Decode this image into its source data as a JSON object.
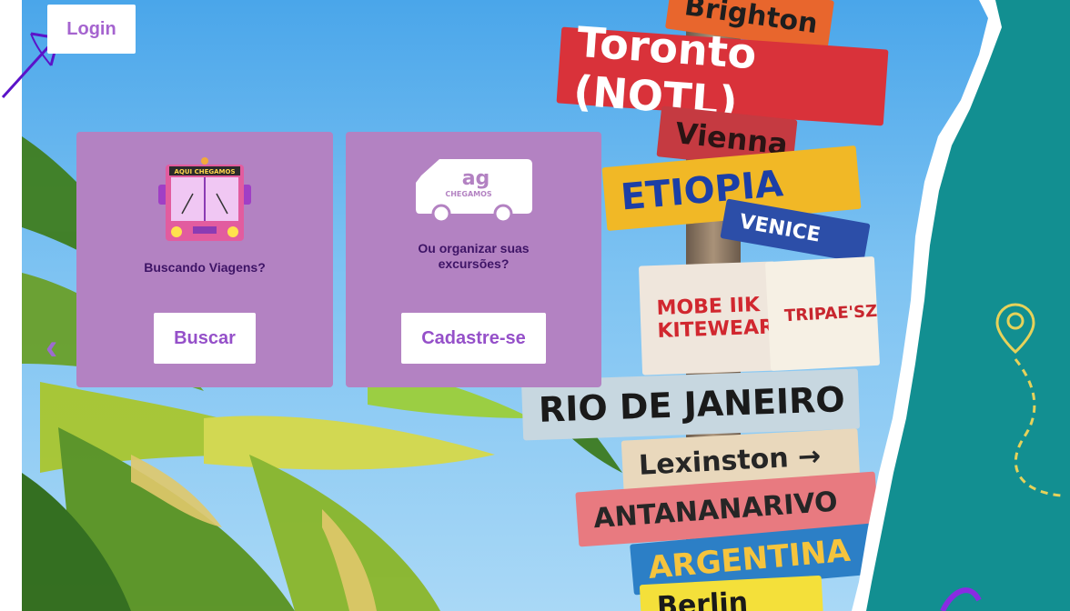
{
  "login_label": "Login",
  "carousel_prev_glyph": "‹",
  "cards": {
    "travel": {
      "bus_sign": "AQUI CHEGAMOS",
      "prompt": "Buscando Viagens?",
      "button_label": "Buscar"
    },
    "organizer": {
      "logo_brand": "CHEGAMOS",
      "prompt": "Ou organizar suas excursões?",
      "button_label": "Cadastre-se"
    }
  },
  "signs": [
    "Brighton",
    "Toronto (NOTL)",
    "Vienna",
    "ETIOPIA",
    "VENICE",
    "MOBE IIK KITEWEAR",
    "TRIPAE'SZ",
    "RIO DE JANEIRO",
    "Lexinston →",
    "ANTANANARIVO",
    "ARGENTINA",
    "Berlin"
  ],
  "colors": {
    "card_bg": "#b382c2",
    "brand_purple": "#9550c9",
    "teal": "#128f91",
    "sky": "#7ec3f2"
  },
  "icons": [
    "arrow-annotation-icon",
    "bus-icon",
    "van-logo-icon",
    "map-pin-icon",
    "chevron-left-icon"
  ]
}
